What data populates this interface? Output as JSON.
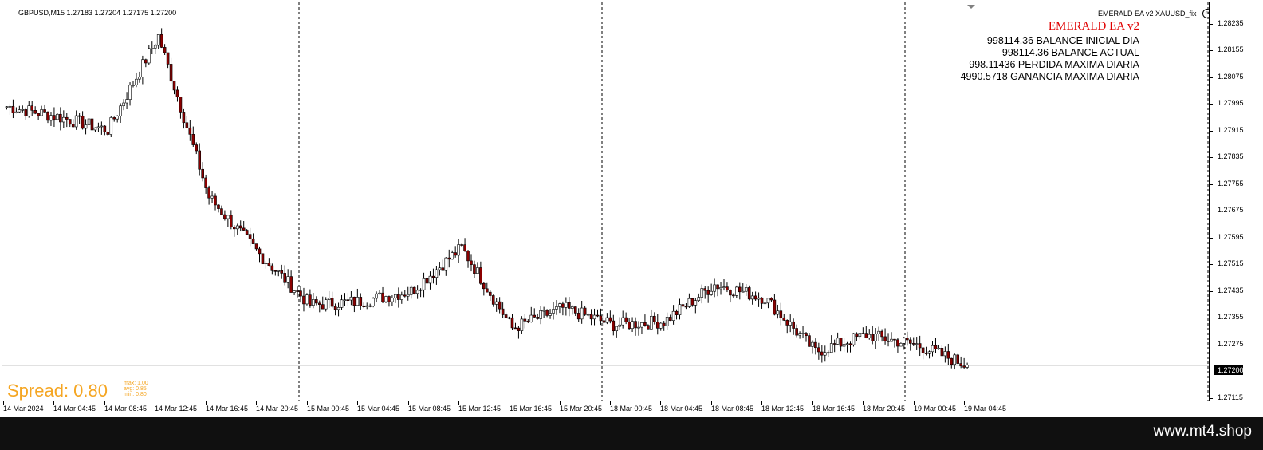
{
  "chart": {
    "symbol_info": "GBPUSD,M15  1.27183 1.27204 1.27175 1.27200",
    "ea_small_title": "EMERALD EA  v2 XAUUSD_fix",
    "ea_title": "EMERALD EA v2",
    "stats": [
      "998114.36 BALANCE INICIAL DIA",
      "998114.36 BALANCE ACTUAL",
      "-998.11436 PERDIDA MAXIMA DIARIA",
      "4990.5718 GANANCIA MAXIMA DIARIA"
    ],
    "current_price": "1.27200",
    "price_ticks": [
      "1.28235",
      "1.28155",
      "1.28075",
      "1.27995",
      "1.27915",
      "1.27835",
      "1.27755",
      "1.27675",
      "1.27595",
      "1.27515",
      "1.27435",
      "1.27355",
      "1.27275",
      "1.27115"
    ],
    "time_ticks": [
      "14 Mar 2024",
      "14 Mar 04:45",
      "14 Mar 08:45",
      "14 Mar 12:45",
      "14 Mar 16:45",
      "14 Mar 20:45",
      "15 Mar 00:45",
      "15 Mar 04:45",
      "15 Mar 08:45",
      "15 Mar 12:45",
      "15 Mar 16:45",
      "15 Mar 20:45",
      "18 Mar 00:45",
      "18 Mar 04:45",
      "18 Mar 08:45",
      "18 Mar 12:45",
      "18 Mar 16:45",
      "18 Mar 20:45",
      "19 Mar 00:45",
      "19 Mar 04:45"
    ],
    "spread_label": "Spread: 0.80",
    "spread_stats": [
      "max: 1.00",
      "avg: 0.85",
      "min: 0.80"
    ],
    "colors": {
      "bull": "#ffffff",
      "bear": "#8b0000",
      "spread": "#f5a623",
      "ea_title": "#e00000"
    },
    "price_range": [
      1.2709,
      1.2828
    ]
  },
  "chart_data": {
    "type": "candlestick",
    "x_label": "time",
    "y_label": "price",
    "ylim": [
      1.2709,
      1.2828
    ],
    "trend_close_points": [
      [
        "14 Mar 2024",
        1.2797
      ],
      [
        "14 Mar 04:45",
        1.2794
      ],
      [
        "14 Mar 08:45",
        1.279
      ],
      [
        "14 Mar 12:45",
        1.2818
      ],
      [
        "14 Mar 16:45",
        1.277
      ],
      [
        "14 Mar 20:45",
        1.2753
      ],
      [
        "15 Mar 00:45",
        1.2738
      ],
      [
        "15 Mar 04:45",
        1.2739
      ],
      [
        "15 Mar 08:45",
        1.2742
      ],
      [
        "15 Mar 12:45",
        1.2755
      ],
      [
        "15 Mar 16:45",
        1.2731
      ],
      [
        "15 Mar 20:45",
        1.2737
      ],
      [
        "18 Mar 00:45",
        1.2732
      ],
      [
        "18 Mar 04:45",
        1.2733
      ],
      [
        "18 Mar 08:45",
        1.2744
      ],
      [
        "18 Mar 12:45",
        1.274
      ],
      [
        "18 Mar 16:45",
        1.2724
      ],
      [
        "18 Mar 20:45",
        1.2729
      ],
      [
        "19 Mar 00:45",
        1.2726
      ],
      [
        "19 Mar 04:45",
        1.272
      ]
    ]
  },
  "footer": {
    "url": "www.mt4.shop"
  }
}
